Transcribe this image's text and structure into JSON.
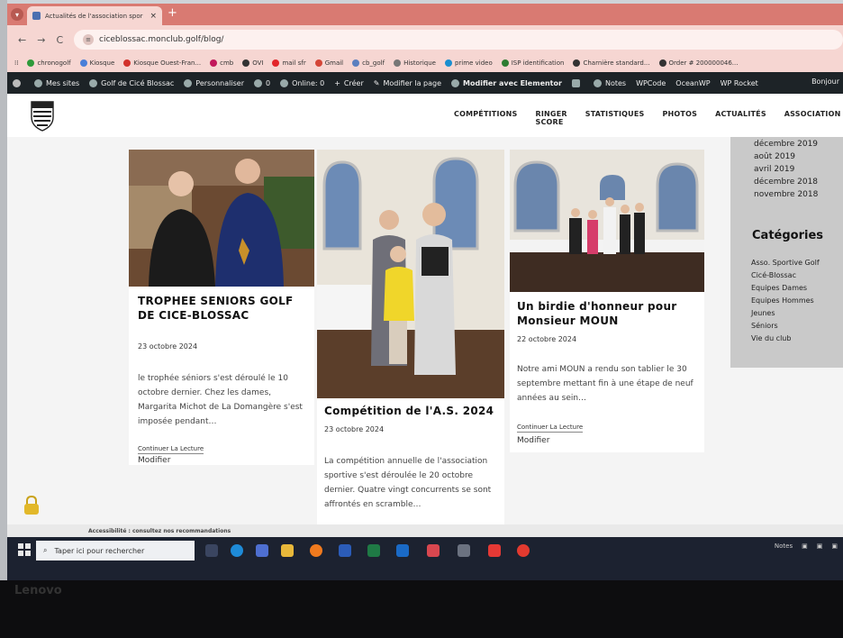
{
  "browser": {
    "tab_title": "Actualités de l'association spor",
    "tab_close": "×",
    "new_tab": "+",
    "url": "ciceblossac.monclub.golf/blog/",
    "bookmarks": [
      "chronogolf",
      "Kiosque",
      "Kiosque Ouest-Fran...",
      "cmb",
      "OVI",
      "mail sfr",
      "Gmail",
      "cb_golf",
      "Historique",
      "prime video",
      "ISP identification",
      "Charnière standard...",
      "Order # 200000046..."
    ]
  },
  "wp_admin": {
    "items": [
      "Mes sites",
      "Golf de Cicé Blossac",
      "Personnaliser",
      "0",
      "Online: 0",
      "Créer",
      "Modifier la page",
      "Modifier avec Elementor",
      "Notes",
      "WPCode",
      "OceanWP",
      "WP Rocket"
    ],
    "greeting": "Bonjour"
  },
  "site": {
    "nav": [
      "COMPÉTITIONS",
      "RINGER SCORE",
      "STATISTIQUES",
      "PHOTOS",
      "ACTUALITÉS",
      "ASSOCIATION"
    ]
  },
  "posts": [
    {
      "title": "TROPHEE SENIORS GOLF DE CICE-BLOSSAC",
      "date": "23 octobre 2024",
      "excerpt": "le trophée séniors s'est déroulé le 10 octobre dernier. Chez les dames, Margarita Michot de La Domangère s'est imposée pendant…",
      "more": "Continuer La Lecture",
      "edit": "Modifier"
    },
    {
      "title": "Compétition de l'A.S. 2024",
      "date": "23 octobre 2024",
      "excerpt": "La compétition annuelle de l'association sportive s'est déroulée le 20 octobre dernier. Quatre vingt concurrents se sont affrontés en scramble…"
    },
    {
      "title": "Un birdie d'honneur pour Monsieur MOUN",
      "date": "22 octobre 2024",
      "excerpt": "Notre ami MOUN a rendu son tablier le 30 septembre mettant fin à une étape de neuf années au sein…",
      "more": "Continuer La Lecture",
      "edit": "Modifier"
    }
  ],
  "sidebar": {
    "archives": [
      "décembre 2019",
      "août 2019",
      "avril 2019",
      "décembre 2018",
      "novembre 2018"
    ],
    "categories_title": "Catégories",
    "categories": [
      "Asso. Sportive Golf",
      "Cicé-Blossac",
      "Equipes Dames",
      "Equipes Hommes",
      "Jeunes",
      "Séniors",
      "Vie du club"
    ]
  },
  "statusbar": {
    "text": "Accessibilité : consultez nos recommandations"
  },
  "taskbar": {
    "search_placeholder": "Taper ici pour rechercher",
    "tray_notes": "Notes"
  },
  "device": {
    "brand": "Lenovo"
  },
  "colors": {
    "tab_strip": "#d97a72",
    "toolbar": "#f6d6d2",
    "wp_bar": "#1d2327",
    "sidebar": "#c9c9c9",
    "taskbar": "#1c2230"
  }
}
